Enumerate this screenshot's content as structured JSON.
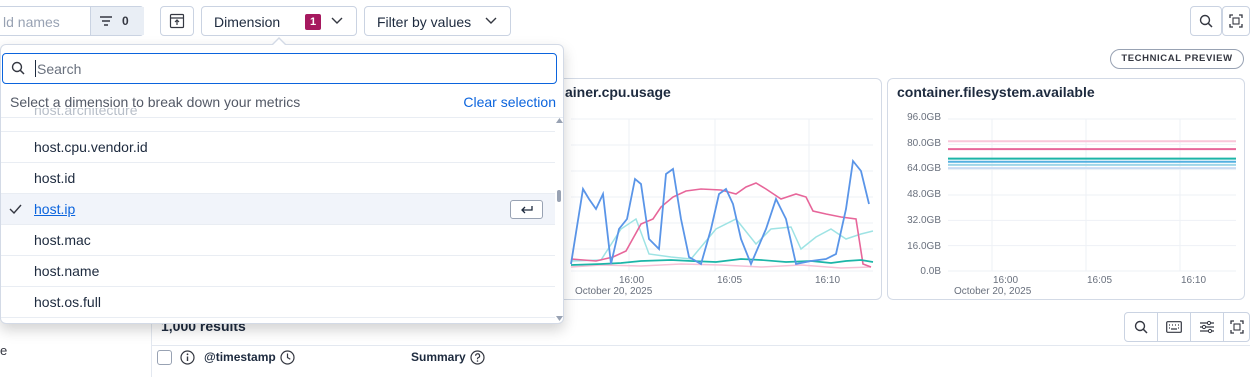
{
  "toolbar": {
    "field_search_placeholder": "ld names",
    "field_filter_count": "0",
    "dimension_label": "Dimension",
    "dimension_count": "1",
    "filter_values_label": "Filter by values",
    "technical_preview": "TECHNICAL PREVIEW"
  },
  "popover": {
    "search_placeholder": "Search",
    "hint": "Select a dimension to break down your metrics",
    "clear_selection": "Clear selection",
    "options": [
      {
        "label": "host.cpu.vendor.id",
        "selected": false
      },
      {
        "label": "host.id",
        "selected": false
      },
      {
        "label": "host.ip",
        "selected": true
      },
      {
        "label": "host.mac",
        "selected": false
      },
      {
        "label": "host.name",
        "selected": false
      },
      {
        "label": "host.os.full",
        "selected": false
      }
    ]
  },
  "charts": {
    "cpu": {
      "title": "ainer.cpu.usage",
      "x_ticks": [
        "16:00",
        "16:05",
        "16:10"
      ],
      "x_subtitle": "October 20, 2025"
    },
    "fs": {
      "title": "container.filesystem.available",
      "y_ticks": [
        "96.0GB",
        "80.0GB",
        "64.0GB",
        "48.0GB",
        "32.0GB",
        "16.0GB",
        "0.0B"
      ],
      "x_ticks": [
        "16:00",
        "16:05",
        "16:10"
      ],
      "x_subtitle": "October 20, 2025"
    }
  },
  "chart_data": [
    {
      "type": "line",
      "title": "container.filesystem.available",
      "y_unit": "GB",
      "ylim": [
        0,
        96
      ],
      "x": [
        "15:58",
        "16:12"
      ],
      "series": [
        {
          "color": "#f9c6d9",
          "values": [
            82,
            82
          ]
        },
        {
          "color": "#e7669a",
          "values": [
            77,
            77
          ]
        },
        {
          "color": "#1cb5a8",
          "values": [
            71,
            71
          ]
        },
        {
          "color": "#54b0e0",
          "values": [
            69,
            69
          ]
        },
        {
          "color": "#9fd6e8",
          "values": [
            67,
            67
          ]
        },
        {
          "color": "#c9dcf3",
          "values": [
            65,
            65
          ]
        }
      ],
      "grid": true
    }
  ],
  "results": {
    "count": "1,000 results",
    "col_timestamp": "@timestamp",
    "col_summary": "Summary",
    "left_fragment": "e"
  }
}
